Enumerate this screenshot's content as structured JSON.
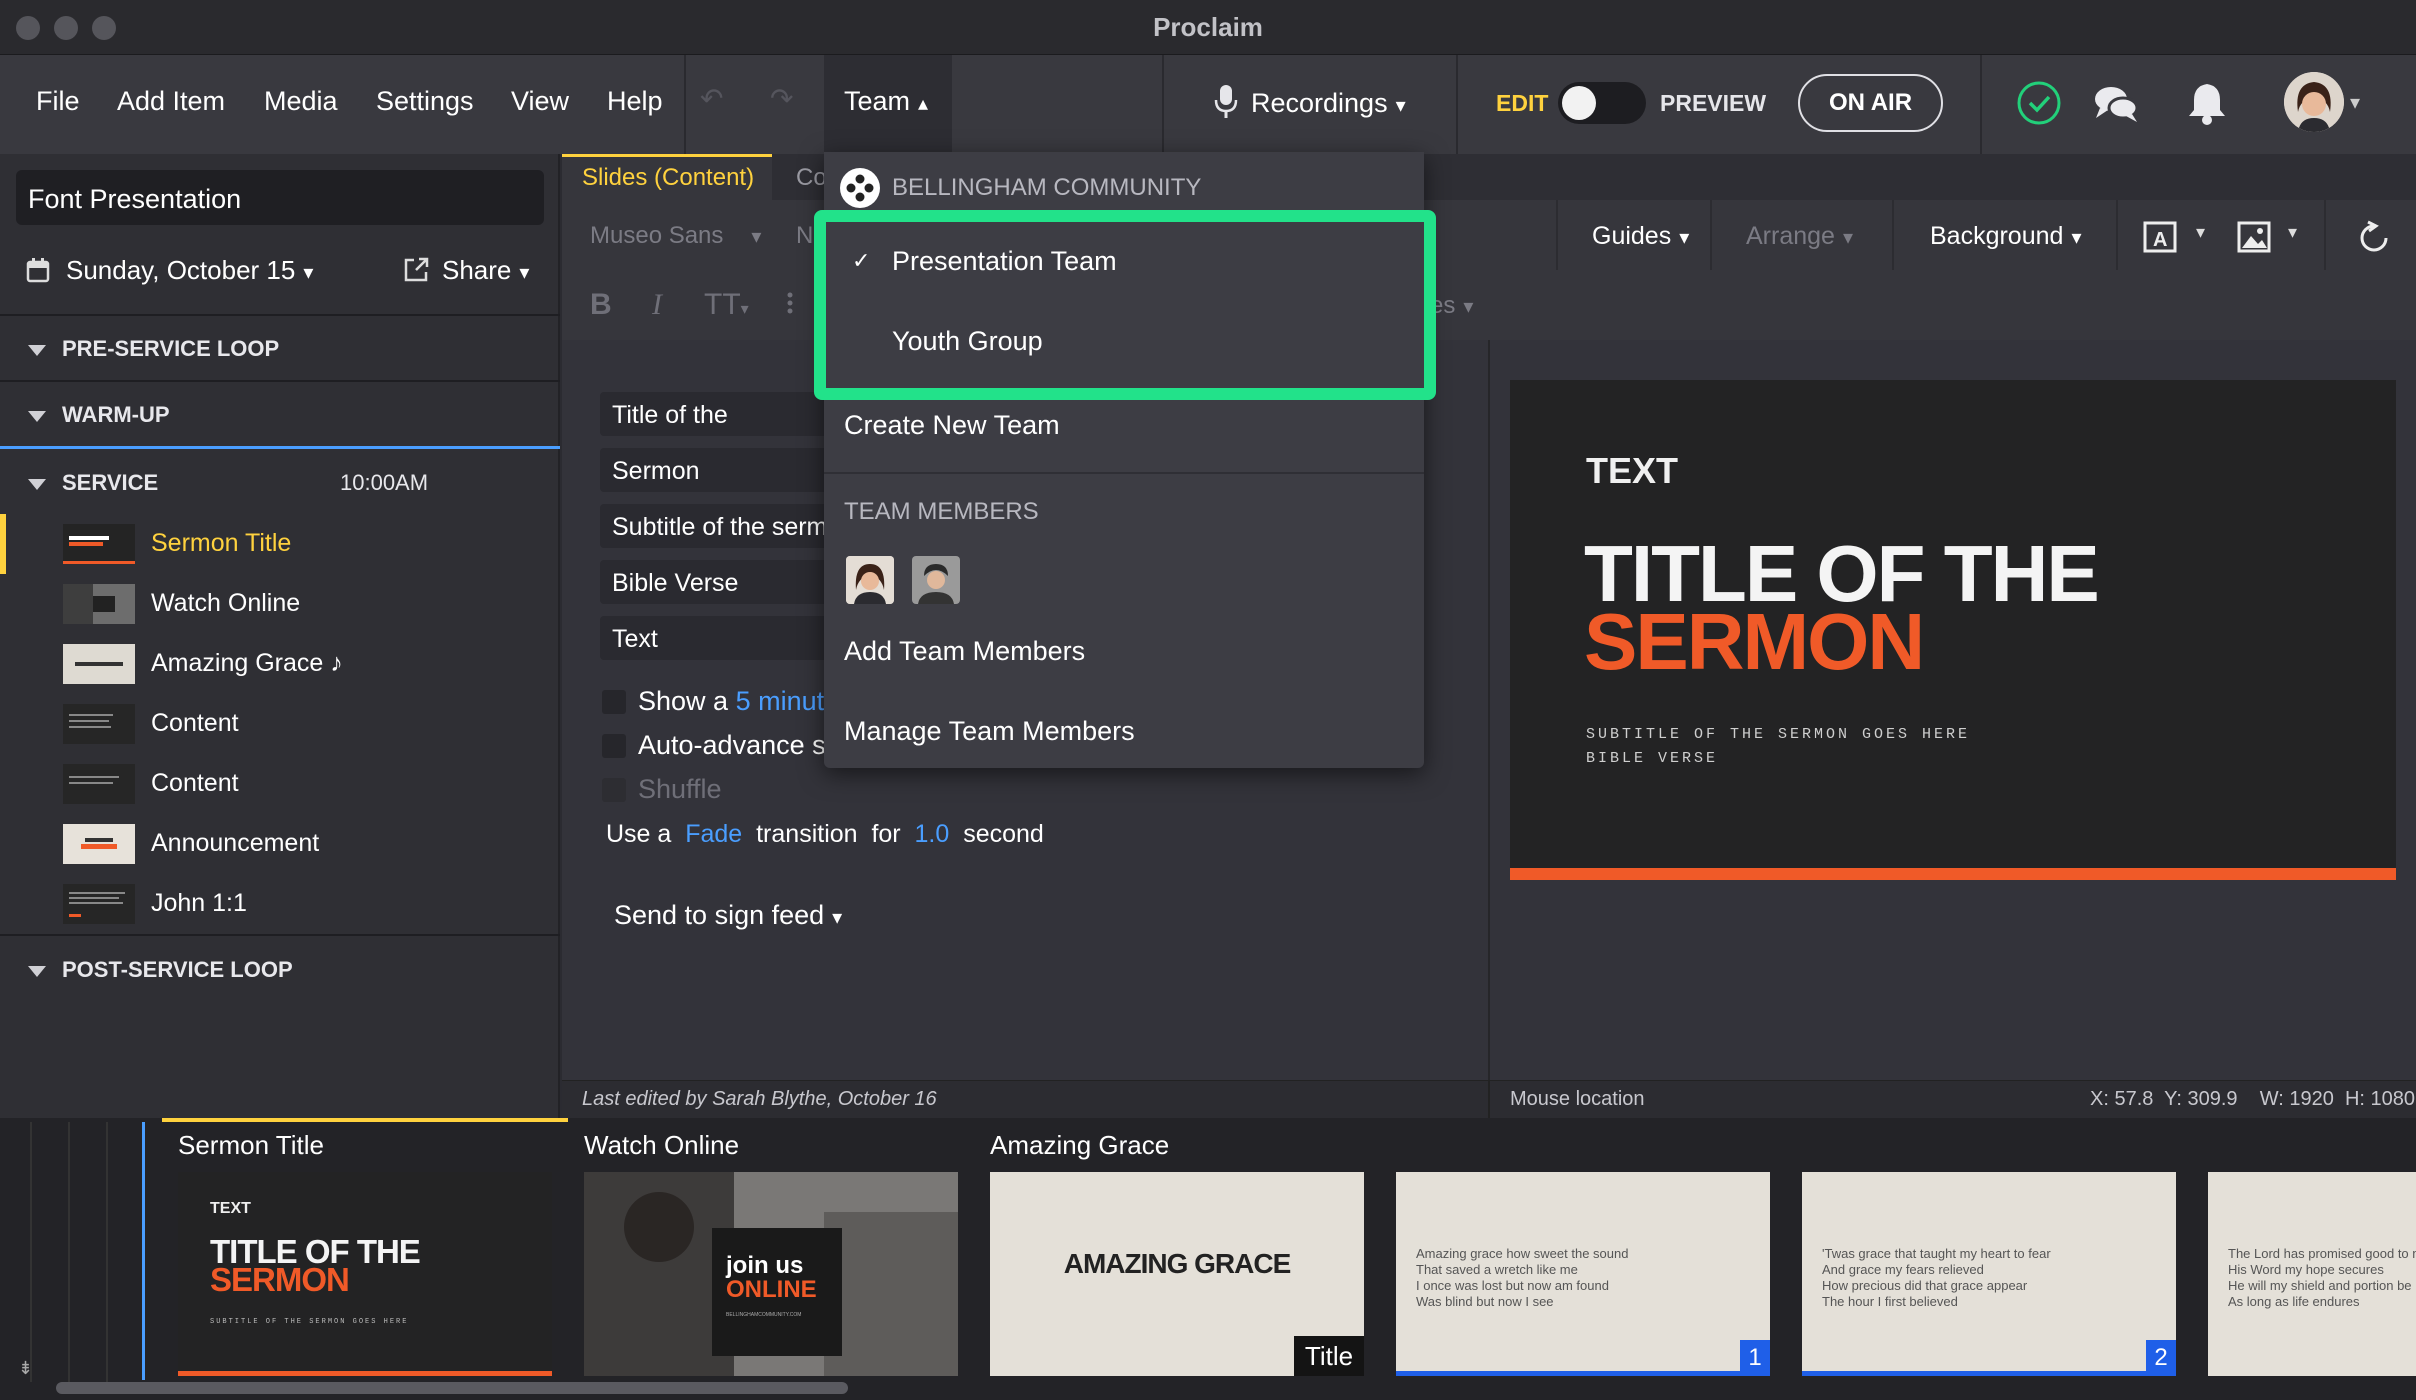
{
  "window": {
    "title": "Proclaim"
  },
  "menubar": {
    "file": "File",
    "add_item": "Add Item",
    "media": "Media",
    "settings": "Settings",
    "view": "View",
    "help": "Help",
    "team": "Team",
    "recordings": "Recordings",
    "edit": "EDIT",
    "preview": "PREVIEW",
    "on_air": "ON AIR"
  },
  "sidebar": {
    "presentation_name": "Font Presentation",
    "date": "Sunday, October 15",
    "share": "Share",
    "sections": {
      "pre_service": "PRE-SERVICE LOOP",
      "warm_up": "WARM-UP",
      "service": "SERVICE",
      "service_time": "10:00AM",
      "post_service": "POST-SERVICE LOOP"
    },
    "items": [
      {
        "label": "Sermon Title"
      },
      {
        "label": "Watch Online"
      },
      {
        "label": "Amazing Grace",
        "note": "♪"
      },
      {
        "label": "Content"
      },
      {
        "label": "Content"
      },
      {
        "label": "Announcement"
      },
      {
        "label": "John 1:1"
      }
    ]
  },
  "editor": {
    "tab_active": "Slides (Content)",
    "tab_next": "Co",
    "font_name": "Museo Sans",
    "font_partial": "N",
    "guides": "Guides",
    "arrange": "Arrange",
    "background": "Background",
    "format_bold": "B",
    "format_italic": "I",
    "format_size": "TT",
    "es_partial": "es",
    "fields": [
      "Title of the",
      "Sermon",
      "Subtitle of the serm",
      "Bible Verse",
      "Text"
    ],
    "opt_show_prefix": "Show a",
    "opt_show_link": "5 minut",
    "opt_auto": "Auto-advance sl",
    "opt_shuffle": "Shuffle",
    "transition": {
      "use_a": "Use a",
      "effect": "Fade",
      "for": "transition  for",
      "duration": "1.0",
      "unit": "second"
    },
    "sign_feed": "Send to sign feed",
    "last_edited": "Last edited by Sarah Blythe, October 16"
  },
  "preview": {
    "label": "TEXT",
    "title_line1": "TITLE OF THE",
    "title_line2": "SERMON",
    "subtitle": "SUBTITLE OF THE SERMON GOES HERE",
    "verse": "BIBLE VERSE",
    "accent_color": "#f05a28",
    "mouse_location": "Mouse location",
    "coords": "X: 57.8  Y: 309.9    W: 1920  H: 1080"
  },
  "team_menu": {
    "org": "BELLINGHAM COMMUNITY",
    "teams": [
      {
        "label": "Presentation Team",
        "checked": "✓"
      },
      {
        "label": "Youth Group",
        "checked": ""
      }
    ],
    "create": "Create New Team",
    "members_header": "TEAM MEMBERS",
    "add_members": "Add Team Members",
    "manage_members": "Manage Team Members",
    "highlight_color": "#22e28a"
  },
  "filmstrip": {
    "cards": [
      {
        "label": "Sermon Title",
        "t_text": "TEXT",
        "t_line1": "TITLE OF THE",
        "t_line2": "SERMON",
        "t_sub": "SUBTITLE OF THE SERMON GOES HERE"
      },
      {
        "label": "Watch Online",
        "join": "join us",
        "online": "ONLINE",
        "url": "BELLINGHAMCOMMUNITY.COM"
      },
      {
        "label": "Amazing Grace",
        "title": "AMAZING GRACE",
        "badge": "Title"
      },
      {
        "lyrics": "Amazing grace how sweet the sound\nThat saved a wretch like me\nI once was lost but now am found\nWas blind but now I see",
        "badge": "1"
      },
      {
        "lyrics": "'Twas grace that taught my heart to fear\nAnd grace my fears relieved\nHow precious did that grace appear\nThe hour I first believed",
        "badge": "2"
      },
      {
        "lyrics": "The Lord has promised good to m\nHis Word my hope secures\nHe will my shield and portion be\nAs long as life endures"
      }
    ]
  }
}
